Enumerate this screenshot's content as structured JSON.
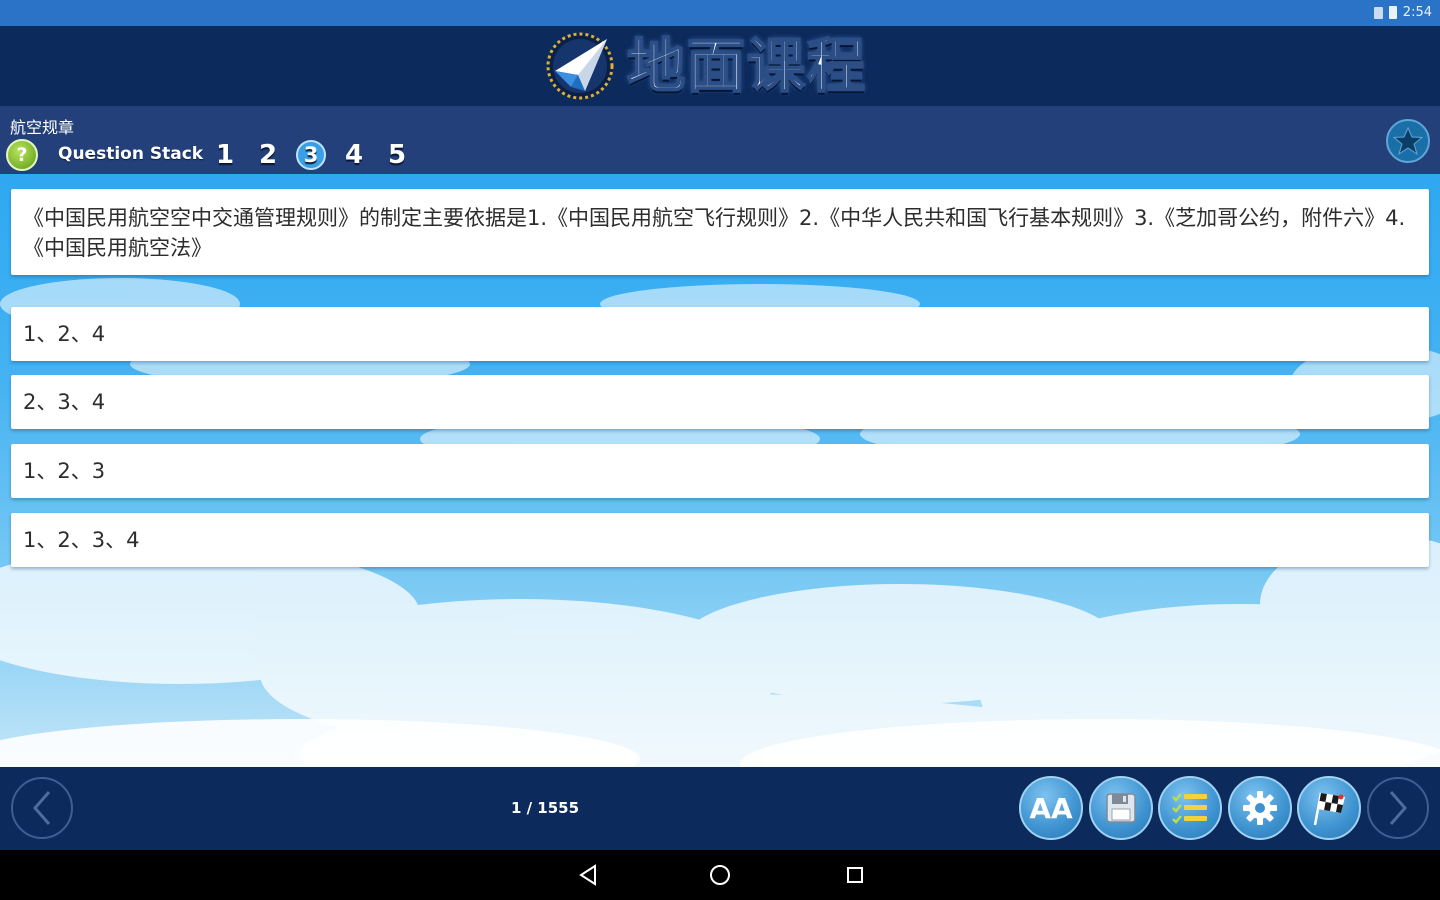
{
  "status_bar": {
    "time": "2:54",
    "icons": [
      "sim-icon",
      "battery-icon"
    ]
  },
  "header": {
    "title": "地面课程",
    "logo_icon": "paper-plane-compass-icon"
  },
  "toolbar": {
    "category": "航空规章",
    "help_label": "?",
    "stack_label": "Question Stack",
    "stack_numbers": [
      "1",
      "2",
      "3",
      "4",
      "5"
    ],
    "active_stack": "3",
    "favorite_icon": "star-icon"
  },
  "question": {
    "text": "《中国民用航空空中交通管理规则》的制定主要依据是1.《中国民用航空飞行规则》2.《中华人民共和国飞行基本规则》3.《芝加哥公约，附件六》4.《中国民用航空法》",
    "options": [
      {
        "text": "1、2、4"
      },
      {
        "text": "2、3、4"
      },
      {
        "text": "1、2、3"
      },
      {
        "text": "1、2、3、4"
      }
    ]
  },
  "bottom_bar": {
    "page_counter": "1 / 1555",
    "font_button_label": "AA",
    "buttons": [
      "font-size-icon",
      "save-icon",
      "checklist-icon",
      "gear-icon",
      "checkered-flag-icon"
    ]
  },
  "colors": {
    "header_bg": "#0c2a5c",
    "toolbar_bg": "#23407a",
    "status_bg": "#2b73c6",
    "sky_top": "#2ea8f1",
    "button_blue": "#3d92cf"
  }
}
